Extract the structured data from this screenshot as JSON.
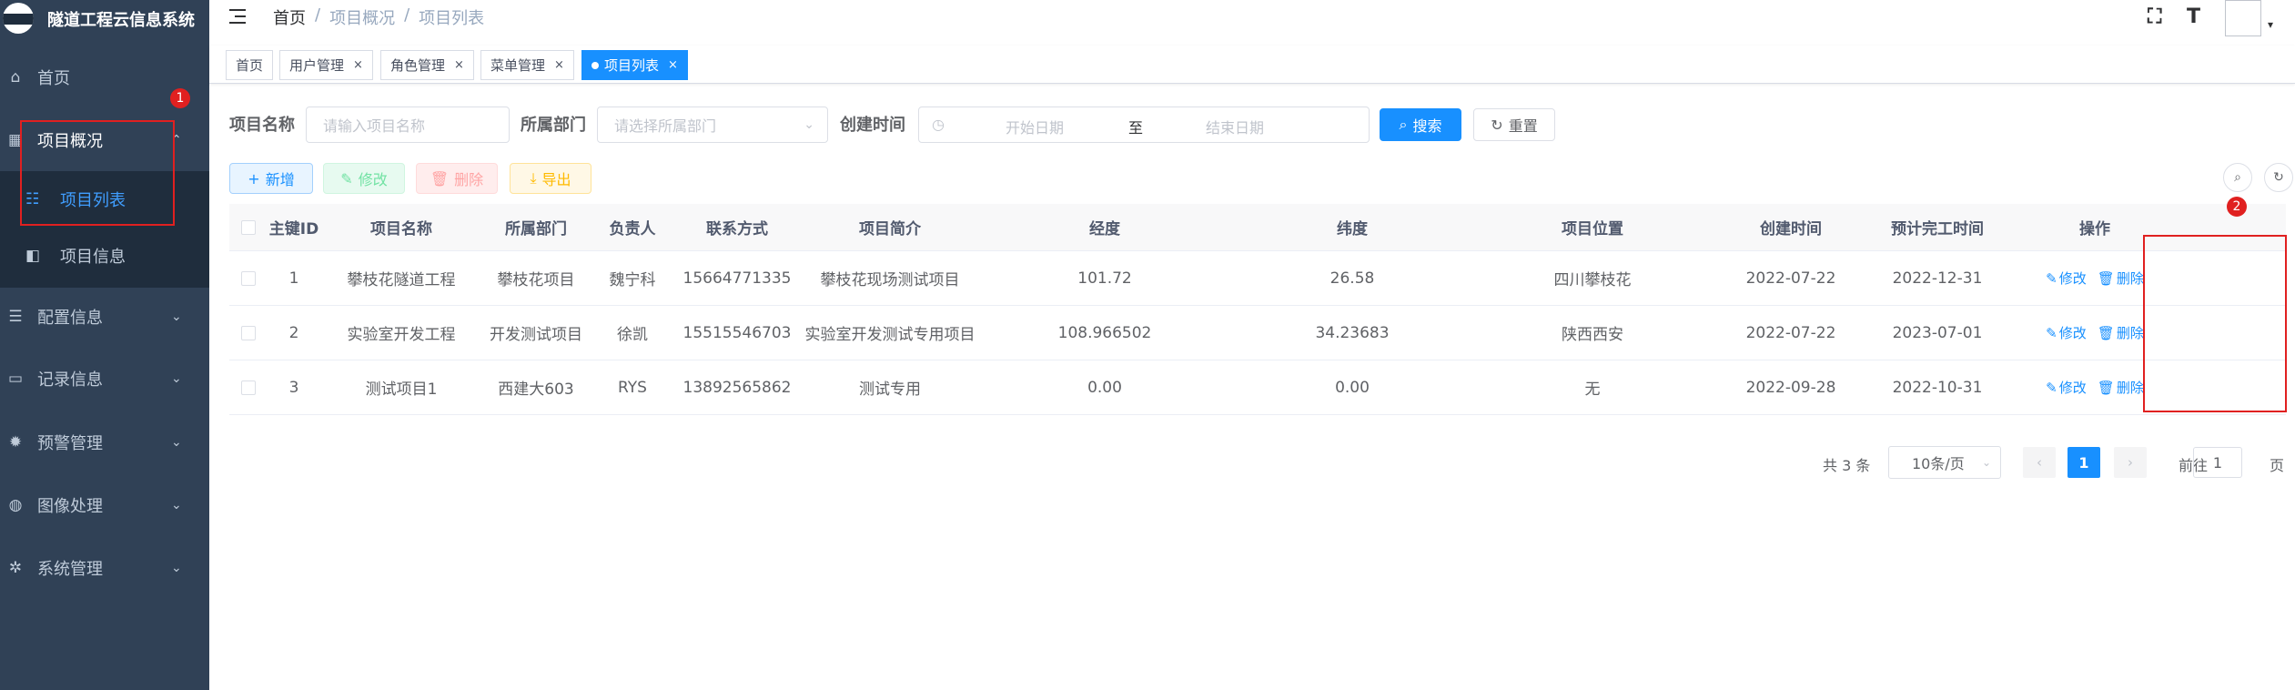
{
  "app": {
    "title": "隧道工程云信息系统"
  },
  "sidebar": {
    "items": [
      {
        "label": "首页",
        "icon": "dashboard-icon",
        "glyph": "⌂"
      },
      {
        "label": "项目概况",
        "icon": "table-icon",
        "glyph": "▦",
        "open": true
      },
      {
        "label": "配置信息",
        "icon": "sliders-icon",
        "glyph": "☰"
      },
      {
        "label": "记录信息",
        "icon": "monitor-icon",
        "glyph": "▭"
      },
      {
        "label": "预警管理",
        "icon": "bug-icon",
        "glyph": "✹"
      },
      {
        "label": "图像处理",
        "icon": "globe-icon",
        "glyph": "◍"
      },
      {
        "label": "系统管理",
        "icon": "settings-icon",
        "glyph": "✲"
      }
    ],
    "submenu": [
      {
        "label": "项目列表",
        "icon": "list-icon",
        "glyph": "☷",
        "active": true
      },
      {
        "label": "项目信息",
        "icon": "book-icon",
        "glyph": "◧"
      }
    ]
  },
  "annotations": {
    "badge1": "1",
    "badge2": "2"
  },
  "navbar": {
    "breadcrumb": [
      "首页",
      "项目概况",
      "项目列表"
    ],
    "separator": "/"
  },
  "tags": [
    {
      "label": "首页"
    },
    {
      "label": "用户管理"
    },
    {
      "label": "角色管理"
    },
    {
      "label": "菜单管理"
    },
    {
      "label": "项目列表",
      "active": true
    }
  ],
  "search": {
    "name_label": "项目名称",
    "name_placeholder": "请输入项目名称",
    "dept_label": "所属部门",
    "dept_placeholder": "请选择所属部门",
    "time_label": "创建时间",
    "start_placeholder": "开始日期",
    "range_sep": "至",
    "end_placeholder": "结束日期",
    "search_btn": "搜索",
    "reset_btn": "重置"
  },
  "toolbar": {
    "add": "新增",
    "edit": "修改",
    "delete": "删除",
    "export": "导出"
  },
  "table": {
    "columns": [
      "主键ID",
      "项目名称",
      "所属部门",
      "负责人",
      "联系方式",
      "项目简介",
      "经度",
      "纬度",
      "项目位置",
      "创建时间",
      "预计完工时间",
      "操作"
    ],
    "rows": [
      {
        "id": "1",
        "name": "攀枝花隧道工程",
        "dept": "攀枝花项目",
        "owner": "魏宁科",
        "phone": "15664771335",
        "intro": "攀枝花现场测试项目",
        "lng": "101.72",
        "lat": "26.58",
        "location": "四川攀枝花",
        "created": "2022-07-22",
        "finish": "2022-12-31"
      },
      {
        "id": "2",
        "name": "实验室开发工程",
        "dept": "开发测试项目",
        "owner": "徐凯",
        "phone": "15515546703",
        "intro": "实验室开发测试专用项目",
        "lng": "108.966502",
        "lat": "34.23683",
        "location": "陕西西安",
        "created": "2022-07-22",
        "finish": "2023-07-01"
      },
      {
        "id": "3",
        "name": "测试项目1",
        "dept": "西建大603",
        "owner": "RYS",
        "phone": "13892565862",
        "intro": "测试专用",
        "lng": "0.00",
        "lat": "0.00",
        "location": "无",
        "created": "2022-09-28",
        "finish": "2022-10-31"
      }
    ],
    "op_edit": "修改",
    "op_delete": "删除"
  },
  "pagination": {
    "total": "共 3 条",
    "page_size": "10条/页",
    "current": "1",
    "goto_prefix": "前往",
    "goto_value": "1",
    "goto_suffix": "页"
  }
}
